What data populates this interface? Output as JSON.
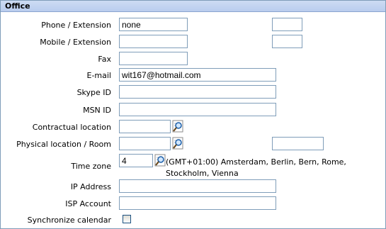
{
  "section": {
    "title": "Office"
  },
  "fields": {
    "phone": {
      "label": "Phone / Extension",
      "value": "none",
      "ext_value": ""
    },
    "mobile": {
      "label": "Mobile / Extension",
      "value": "",
      "ext_value": ""
    },
    "fax": {
      "label": "Fax",
      "value": ""
    },
    "email": {
      "label": "E-mail",
      "value": "wit167@hotmail.com"
    },
    "skype": {
      "label": "Skype ID",
      "value": ""
    },
    "msn": {
      "label": "MSN ID",
      "value": ""
    },
    "contractual_location": {
      "label": "Contractual location",
      "value": ""
    },
    "physical_location": {
      "label": "Physical location / Room",
      "value": "",
      "room_value": ""
    },
    "time_zone": {
      "label": "Time zone",
      "value": "4",
      "description": "(GMT+01:00) Amsterdam, Berlin, Bern, Rome, Stockholm, Vienna"
    },
    "ip_address": {
      "label": "IP Address",
      "value": ""
    },
    "isp_account": {
      "label": "ISP Account",
      "value": ""
    },
    "sync_calendar": {
      "label": "Synchronize calendar",
      "checked": false
    }
  },
  "icons": {
    "lookup": "magnifier-lookup-icon"
  }
}
